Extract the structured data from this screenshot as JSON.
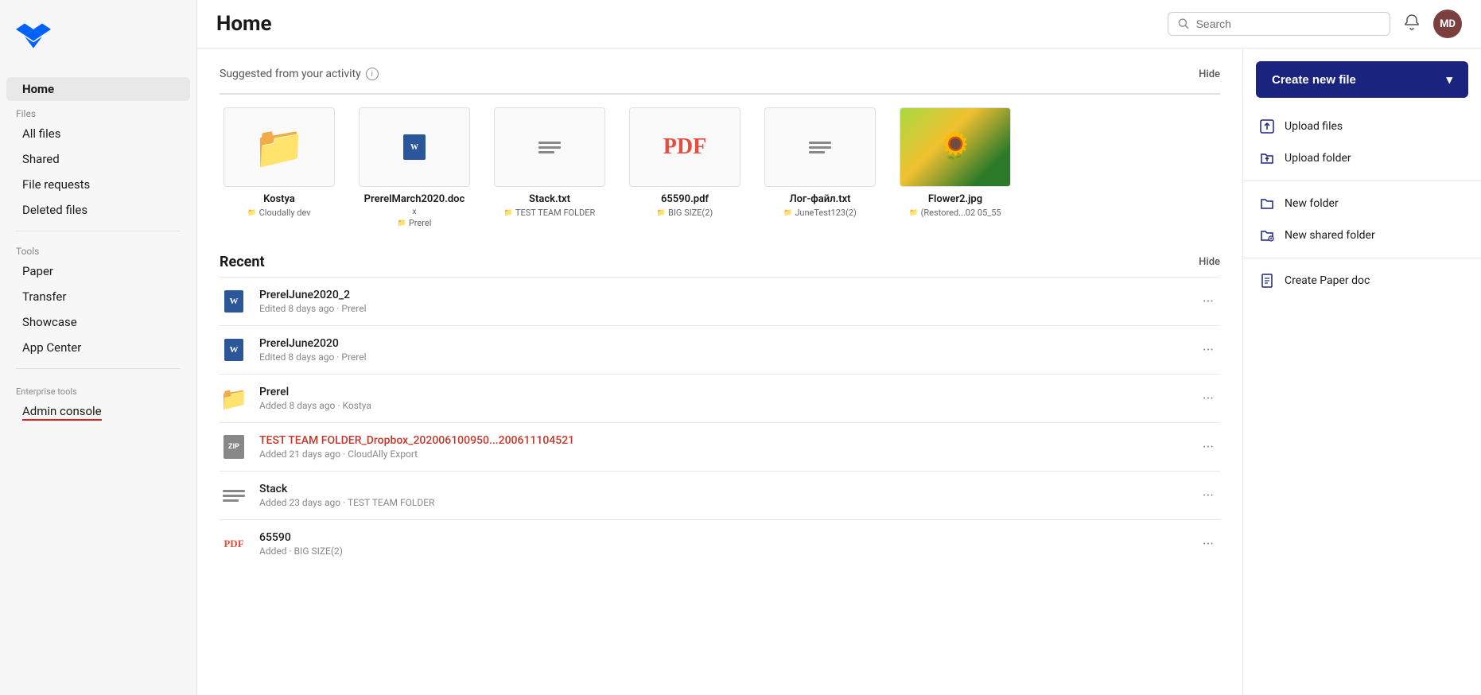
{
  "sidebar": {
    "logo_alt": "Dropbox logo",
    "nav_items": [
      {
        "id": "home",
        "label": "Home",
        "active": true
      },
      {
        "id": "all-files",
        "label": "All files",
        "active": false
      },
      {
        "id": "shared",
        "label": "Shared",
        "active": false
      },
      {
        "id": "file-requests",
        "label": "File requests",
        "active": false
      },
      {
        "id": "deleted-files",
        "label": "Deleted files",
        "active": false
      }
    ],
    "files_label": "Files",
    "tools_label": "Tools",
    "tools_items": [
      {
        "id": "paper",
        "label": "Paper"
      },
      {
        "id": "transfer",
        "label": "Transfer"
      },
      {
        "id": "showcase",
        "label": "Showcase"
      },
      {
        "id": "app-center",
        "label": "App Center"
      }
    ],
    "enterprise_label": "Enterprise tools",
    "admin_label": "Admin console"
  },
  "topbar": {
    "page_title": "Home",
    "search_placeholder": "Search",
    "avatar_initials": "MD"
  },
  "suggested": {
    "title": "Suggested from your activity",
    "hide_label": "Hide",
    "info_label": "i",
    "files": [
      {
        "id": "kostya",
        "name": "Kostya",
        "type": "folder",
        "location": "Cloudally dev"
      },
      {
        "id": "prerel-march",
        "name": "PrerelMarch2020.docx",
        "type": "word",
        "location": "Prerel"
      },
      {
        "id": "stack-txt",
        "name": "Stack.txt",
        "type": "txt",
        "location": "TEST TEAM FOLDER"
      },
      {
        "id": "65590-pdf",
        "name": "65590.pdf",
        "type": "pdf",
        "location": "BIG SIZE(2)"
      },
      {
        "id": "log-file",
        "name": "Лог-файл.txt",
        "type": "txt",
        "location": "JuneTest123(2)"
      },
      {
        "id": "flower2",
        "name": "Flower2.jpg",
        "type": "image",
        "location": "(Restored...02 05_55"
      }
    ]
  },
  "recent": {
    "title": "Recent",
    "hide_label": "Hide",
    "items": [
      {
        "id": "prerel-june2",
        "name": "PrerelJune2020_2",
        "type": "word",
        "meta": "Edited 8 days ago · Prerel",
        "highlight": false
      },
      {
        "id": "prerel-june",
        "name": "PrerelJune2020",
        "type": "word",
        "meta": "Edited 8 days ago · Prerel",
        "highlight": false
      },
      {
        "id": "prerel-folder",
        "name": "Prerel",
        "type": "folder-detail",
        "meta": "Added 8 days ago · Kostya",
        "highlight": false
      },
      {
        "id": "test-team-zip",
        "name": "TEST TEAM FOLDER_Dropbox_202006100950...200611104521",
        "type": "zip",
        "meta": "Added 21 days ago · CloudAlly Export",
        "highlight": true
      },
      {
        "id": "stack",
        "name": "Stack",
        "type": "txt",
        "meta": "Added 23 days ago · TEST TEAM FOLDER",
        "highlight": false
      },
      {
        "id": "65590",
        "name": "65590",
        "type": "pdf",
        "meta": "Added · BIG SIZE(2)",
        "highlight": false
      }
    ],
    "more_label": "···"
  },
  "dropdown": {
    "create_new_label": "Create new file",
    "chevron": "▾",
    "items": [
      {
        "id": "upload-files",
        "label": "Upload files",
        "icon": "upload-file-icon"
      },
      {
        "id": "upload-folder",
        "label": "Upload folder",
        "icon": "upload-folder-icon"
      },
      {
        "id": "new-folder",
        "label": "New folder",
        "icon": "new-folder-icon"
      },
      {
        "id": "new-shared-folder",
        "label": "New shared folder",
        "icon": "new-shared-folder-icon"
      },
      {
        "id": "create-paper-doc",
        "label": "Create Paper doc",
        "icon": "paper-doc-icon"
      }
    ]
  }
}
